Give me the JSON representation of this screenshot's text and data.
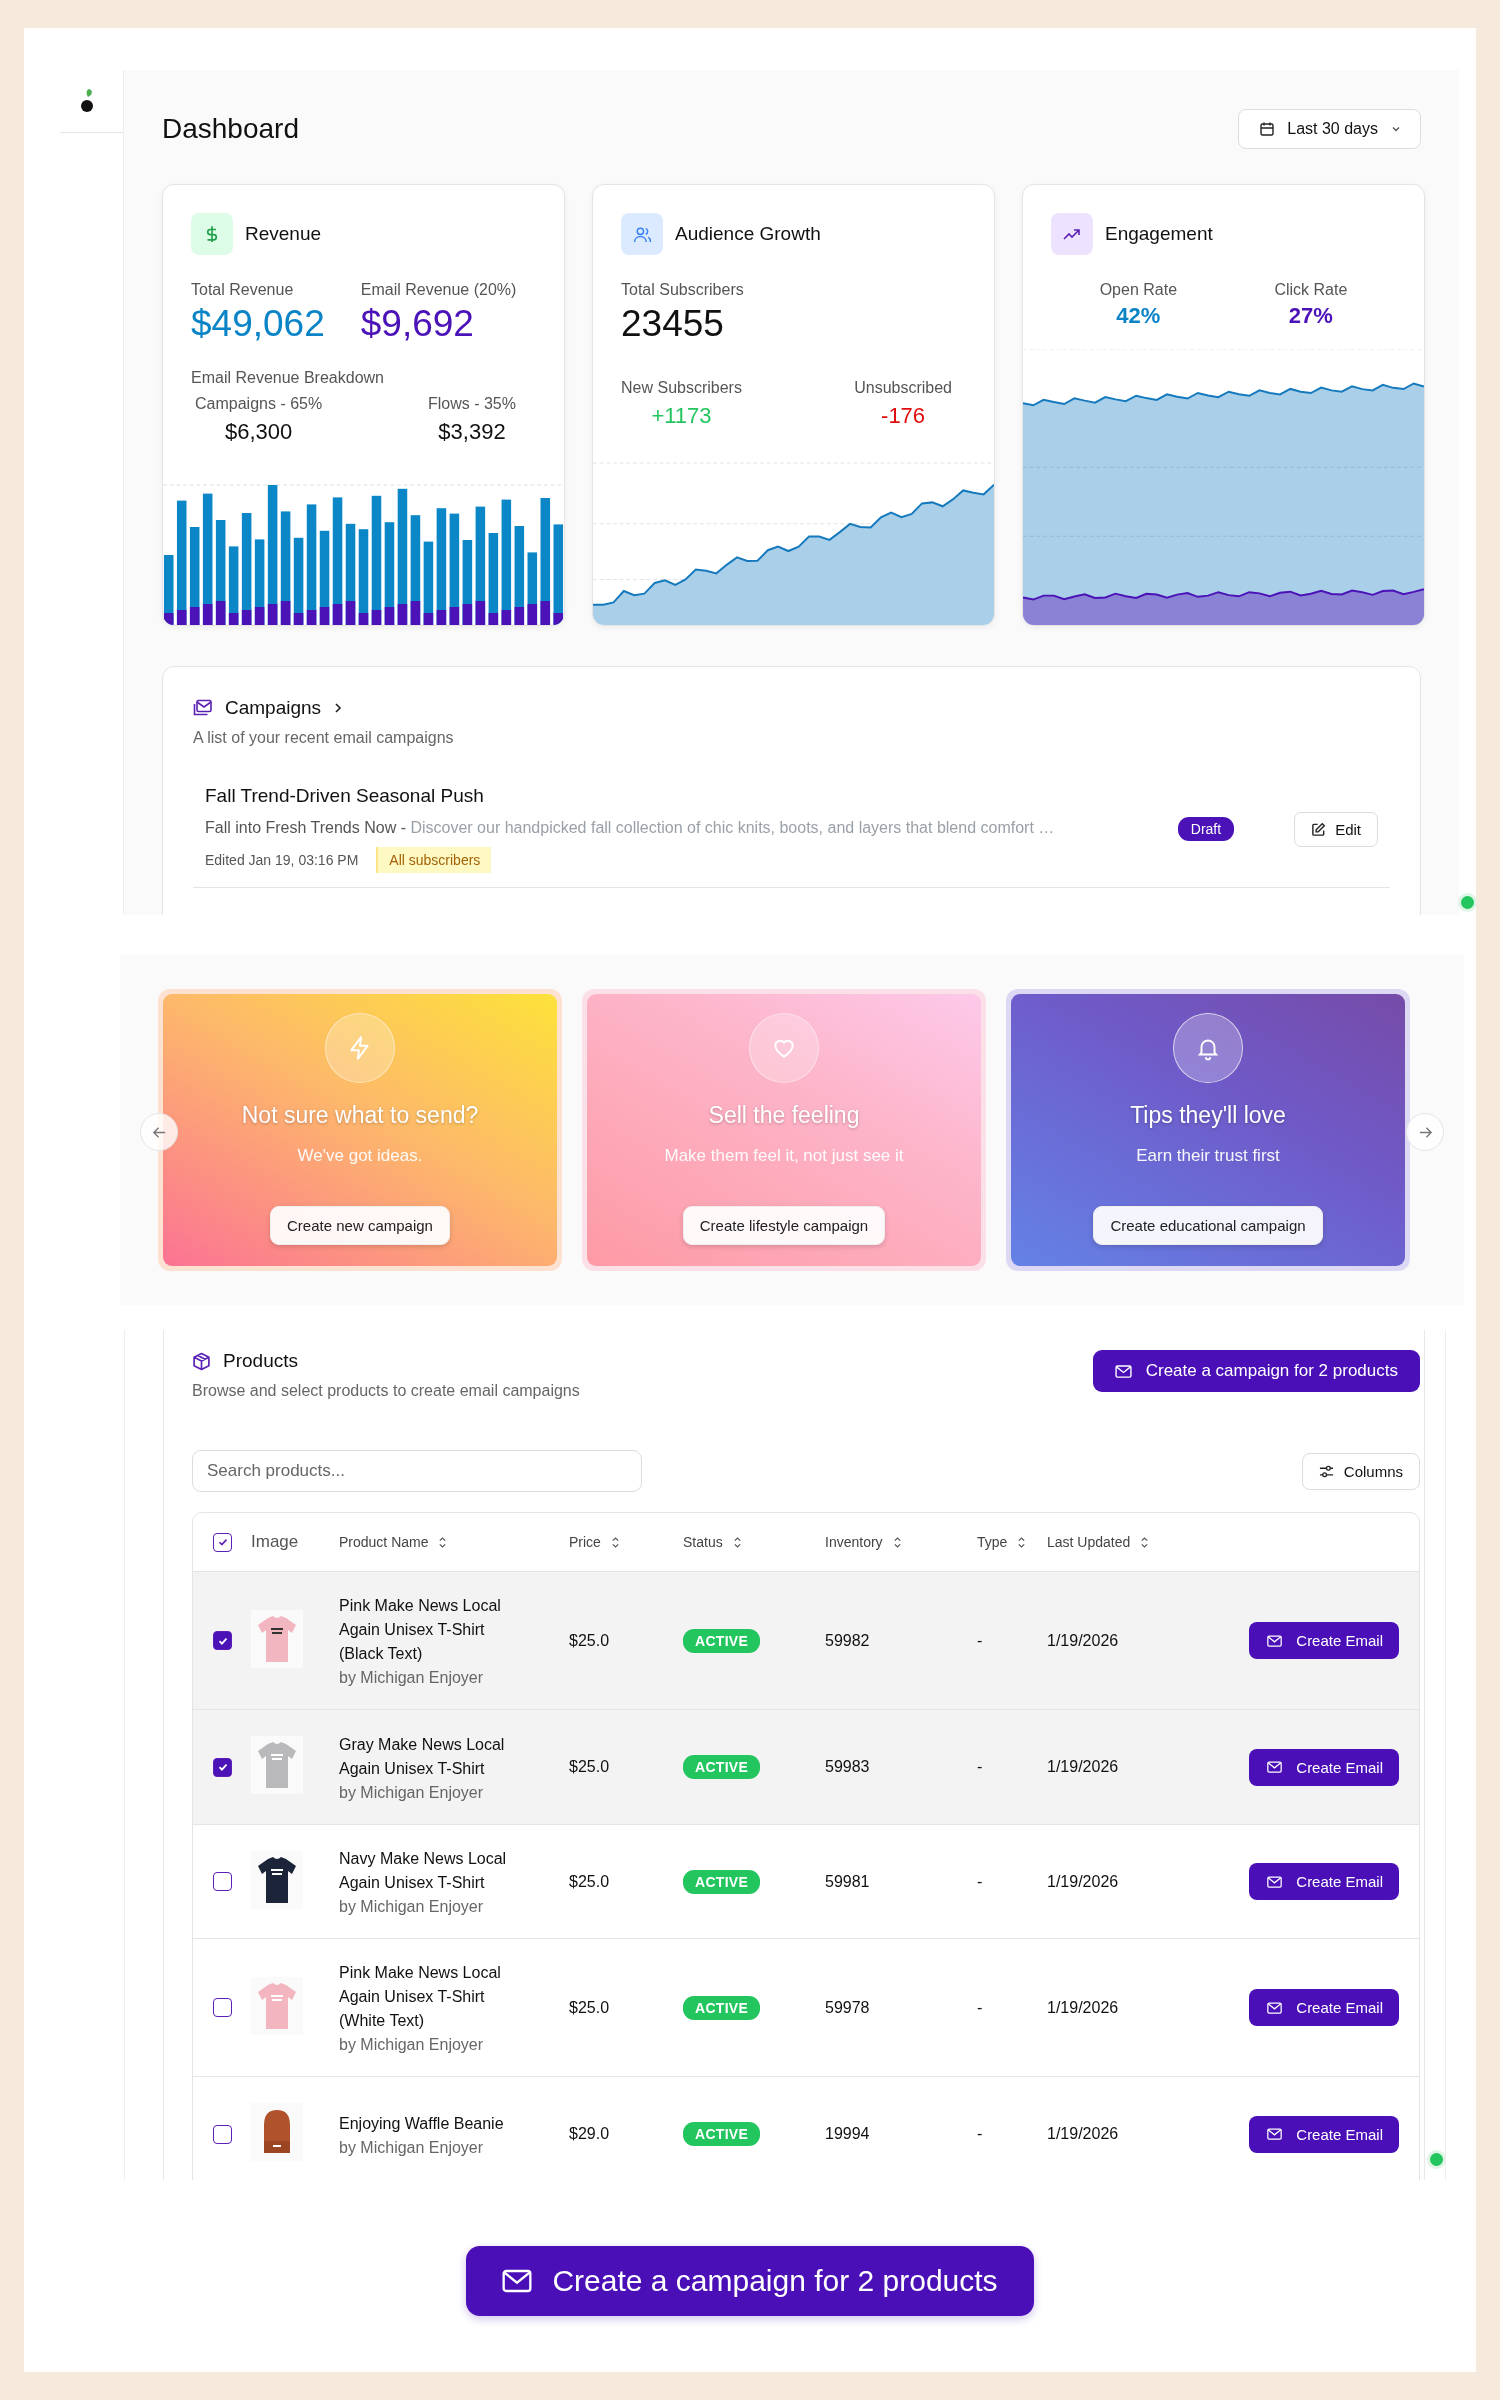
{
  "header": {
    "title": "Dashboard",
    "date_range": "Last 30 days"
  },
  "revenue": {
    "title": "Revenue",
    "total_label": "Total Revenue",
    "total": "$49,062",
    "email_label": "Email Revenue (20%)",
    "email": "$9,692",
    "breakdown_title": "Email Revenue Breakdown",
    "breakdown": [
      {
        "label": "Campaigns - 65%",
        "value": "$6,300"
      },
      {
        "label": "Flows - 35%",
        "value": "$3,392"
      }
    ]
  },
  "audience": {
    "title": "Audience Growth",
    "total_label": "Total Subscribers",
    "total": "23455",
    "stats": [
      {
        "label": "New Subscribers",
        "value": "+1173",
        "color": "#22c55e"
      },
      {
        "label": "Unsubscribed",
        "value": "-176",
        "color": "#e00d0d"
      }
    ]
  },
  "engagement": {
    "title": "Engagement",
    "rates": [
      {
        "label": "Open Rate",
        "value": "42%",
        "color": "#0a84c6"
      },
      {
        "label": "Click Rate",
        "value": "27%",
        "color": "#4b12b8"
      }
    ]
  },
  "campaigns": {
    "title": "Campaigns",
    "subtitle": "A list of your recent email campaigns",
    "items": [
      {
        "name": "Fall Trend-Driven Seasonal Push",
        "subject": "Fall into Fresh Trends Now -",
        "preview": "Discover our handpicked fall collection of chic knits, boots, and layers that blend comfort …",
        "edited": "Edited Jan 19, 03:16 PM",
        "audience": "All subscribers",
        "status": "Draft",
        "action": "Edit"
      }
    ]
  },
  "ideas": [
    {
      "kind": "bolt",
      "title": "Not sure what to send?",
      "subtitle": "We've got ideas.",
      "button": "Create new campaign"
    },
    {
      "kind": "heart",
      "title": "Sell the feeling",
      "subtitle": "Make them feel it, not just see it",
      "button": "Create lifestyle campaign"
    },
    {
      "kind": "bell",
      "title": "Tips they'll love",
      "subtitle": "Earn their trust first",
      "button": "Create educational campaign"
    }
  ],
  "products": {
    "title": "Products",
    "subtitle": "Browse and select products to create email campaigns",
    "cta": "Create a campaign for 2 products",
    "search": {
      "placeholder": "Search products..."
    },
    "columns_button": "Columns",
    "select_all_checked": true,
    "columns": [
      {
        "label": "Image",
        "sortable": false
      },
      {
        "label": "Product Name",
        "sortable": true
      },
      {
        "label": "Price",
        "sortable": true
      },
      {
        "label": "Status",
        "sortable": true
      },
      {
        "label": "Inventory",
        "sortable": true
      },
      {
        "label": "Type",
        "sortable": true
      },
      {
        "label": "Last Updated",
        "sortable": true
      }
    ],
    "rows": [
      {
        "selected": true,
        "name": "Pink Make News Local Again Unisex T-Shirt (Black Text)",
        "vendor": "by Michigan Enjoyer",
        "price": "$25.0",
        "status": "ACTIVE",
        "inventory": "59982",
        "type": "-",
        "updated": "1/19/2026",
        "action": "Create Email"
      },
      {
        "selected": true,
        "name": "Gray Make News Local Again Unisex T-Shirt",
        "vendor": "by Michigan Enjoyer",
        "price": "$25.0",
        "status": "ACTIVE",
        "inventory": "59983",
        "type": "-",
        "updated": "1/19/2026",
        "action": "Create Email"
      },
      {
        "selected": false,
        "name": "Navy Make News Local Again Unisex T-Shirt",
        "vendor": "by Michigan Enjoyer",
        "price": "$25.0",
        "status": "ACTIVE",
        "inventory": "59981",
        "type": "-",
        "updated": "1/19/2026",
        "action": "Create Email"
      },
      {
        "selected": false,
        "name": "Pink Make News Local Again Unisex T-Shirt (White Text)",
        "vendor": "by Michigan Enjoyer",
        "price": "$25.0",
        "status": "ACTIVE",
        "inventory": "59978",
        "type": "-",
        "updated": "1/19/2026",
        "action": "Create Email"
      },
      {
        "selected": false,
        "name": "Enjoying Waffle Beanie",
        "vendor": "by Michigan Enjoyer",
        "price": "$29.0",
        "status": "ACTIVE",
        "inventory": "19994",
        "type": "-",
        "updated": "1/19/2026",
        "action": "Create Email"
      }
    ]
  },
  "footer_cta": "Create a campaign for 2 products"
}
